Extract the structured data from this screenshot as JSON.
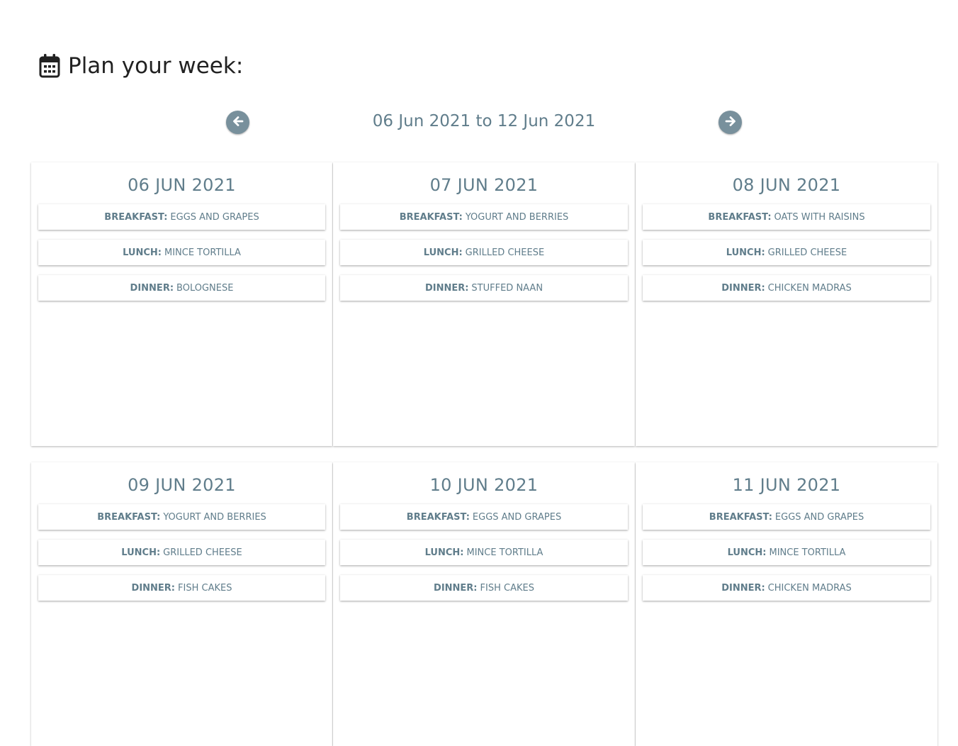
{
  "header": {
    "title": "Plan your week:",
    "icon": "calendar-icon"
  },
  "week_nav": {
    "range": "06 Jun 2021 to 12 Jun 2021",
    "prev_icon": "arrow-left-circle-icon",
    "next_icon": "arrow-right-circle-icon",
    "button_color": "#78909c"
  },
  "colors": {
    "text_accent": "#607d8b",
    "title_text": "#212121"
  },
  "days": [
    {
      "date": "06 JUN 2021",
      "meals": [
        {
          "type": "BREAKFAST:",
          "name": "EGGS AND GRAPES"
        },
        {
          "type": "LUNCH:",
          "name": "MINCE TORTILLA"
        },
        {
          "type": "DINNER:",
          "name": "BOLOGNESE"
        }
      ]
    },
    {
      "date": "07 JUN 2021",
      "meals": [
        {
          "type": "BREAKFAST:",
          "name": "YOGURT AND BERRIES"
        },
        {
          "type": "LUNCH:",
          "name": "GRILLED CHEESE"
        },
        {
          "type": "DINNER:",
          "name": "STUFFED NAAN"
        }
      ]
    },
    {
      "date": "08 JUN 2021",
      "meals": [
        {
          "type": "BREAKFAST:",
          "name": "OATS WITH RAISINS"
        },
        {
          "type": "LUNCH:",
          "name": "GRILLED CHEESE"
        },
        {
          "type": "DINNER:",
          "name": "CHICKEN MADRAS"
        }
      ]
    },
    {
      "date": "09 JUN 2021",
      "meals": [
        {
          "type": "BREAKFAST:",
          "name": "YOGURT AND BERRIES"
        },
        {
          "type": "LUNCH:",
          "name": "GRILLED CHEESE"
        },
        {
          "type": "DINNER:",
          "name": "FISH CAKES"
        }
      ]
    },
    {
      "date": "10 JUN 2021",
      "meals": [
        {
          "type": "BREAKFAST:",
          "name": "EGGS AND GRAPES"
        },
        {
          "type": "LUNCH:",
          "name": "MINCE TORTILLA"
        },
        {
          "type": "DINNER:",
          "name": "FISH CAKES"
        }
      ]
    },
    {
      "date": "11 JUN 2021",
      "meals": [
        {
          "type": "BREAKFAST:",
          "name": "EGGS AND GRAPES"
        },
        {
          "type": "LUNCH:",
          "name": "MINCE TORTILLA"
        },
        {
          "type": "DINNER:",
          "name": "CHICKEN MADRAS"
        }
      ]
    }
  ]
}
